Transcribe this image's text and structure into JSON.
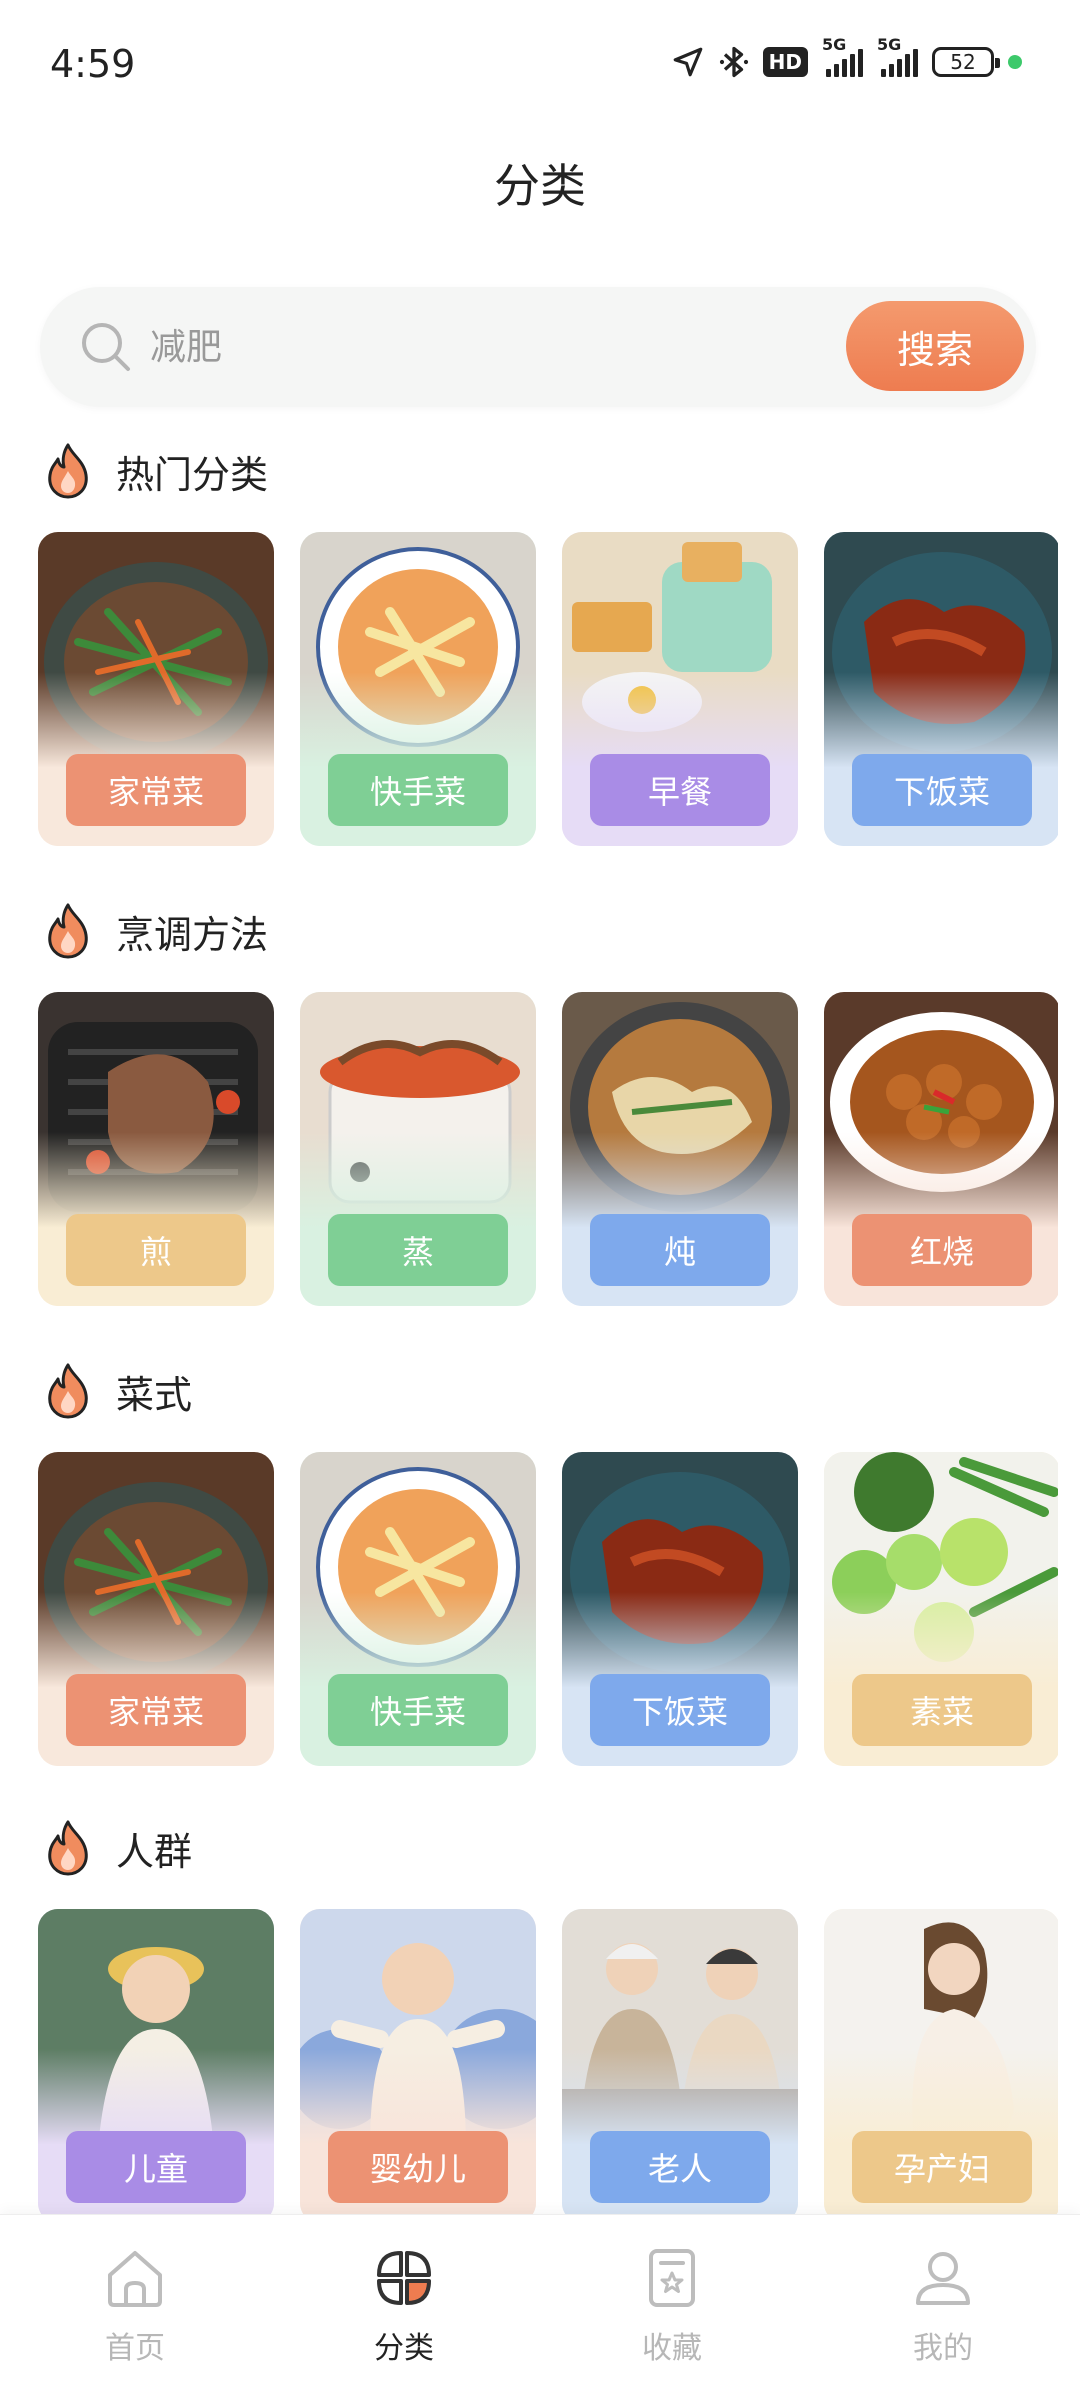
{
  "status_bar": {
    "time": "4:59",
    "hd_badge": "HD",
    "signal1_tag": "5G",
    "signal2_tag": "5G",
    "battery": "52"
  },
  "page": {
    "title": "分类"
  },
  "search": {
    "placeholder": "减肥",
    "button_label": "搜索"
  },
  "sections": [
    {
      "title": "热门分类",
      "cards": [
        "家常菜",
        "快手菜",
        "早餐",
        "下饭菜"
      ]
    },
    {
      "title": "烹调方法",
      "cards": [
        "煎",
        "蒸",
        "炖",
        "红烧"
      ]
    },
    {
      "title": "菜式",
      "cards": [
        "家常菜",
        "快手菜",
        "下饭菜",
        "素菜"
      ]
    },
    {
      "title": "人群",
      "cards": [
        "儿童",
        "婴幼儿",
        "老人",
        "孕产妇"
      ]
    }
  ],
  "colors": {
    "accent": "#ee7c50",
    "label_orange": "#ec9273",
    "label_green": "#7fcf95",
    "label_purple": "#a98ce6",
    "label_blue": "#7ea9ec",
    "label_yellow": "#edc88a"
  },
  "nav": {
    "items": [
      {
        "label": "首页",
        "icon": "home-icon"
      },
      {
        "label": "分类",
        "icon": "category-icon"
      },
      {
        "label": "收藏",
        "icon": "favorites-icon"
      },
      {
        "label": "我的",
        "icon": "profile-icon"
      }
    ],
    "active_index": 1
  }
}
